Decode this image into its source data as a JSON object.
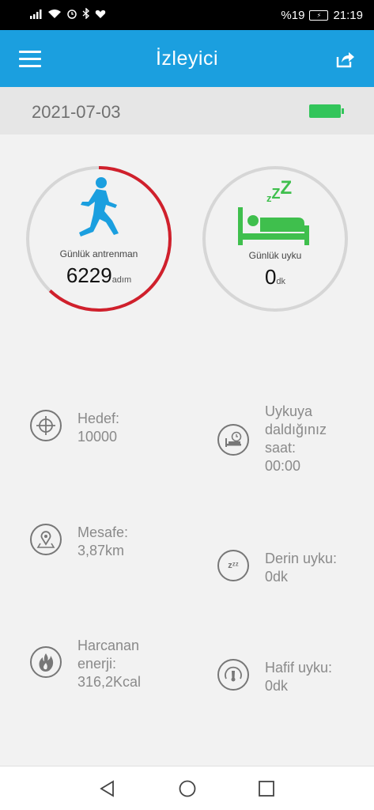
{
  "status": {
    "battery_pct": "%19",
    "time": "21:19",
    "icons": [
      "signal-icon",
      "wifi-icon",
      "alarm-icon",
      "bluetooth-icon",
      "heart-icon",
      "battery-charging-icon"
    ]
  },
  "app": {
    "title": "İzleyici"
  },
  "date": "2021-07-03",
  "exercise": {
    "label": "Günlük antrenman",
    "value": "6229",
    "unit": "adım",
    "progress": 0.62,
    "color": "#d0202c"
  },
  "sleep": {
    "label": "Günlük uyku",
    "value": "0",
    "unit": "dk",
    "progress": 0,
    "color": "#3fbf4d",
    "zzz": "zZZ"
  },
  "stats_left": [
    {
      "label": "Hedef:",
      "value": "10000",
      "icon": "target-icon"
    },
    {
      "label": "Mesafe:",
      "value": "3,87km",
      "icon": "location-pin-icon"
    },
    {
      "label": "Harcanan enerji:",
      "value": "316,2Kcal",
      "icon": "flame-icon"
    }
  ],
  "stats_right": [
    {
      "label": "Uykuya daldığınız saat:",
      "value": "00:00",
      "icon": "bed-clock-icon"
    },
    {
      "label": "Derin uyku:",
      "value": "0dk",
      "icon": "zzz-icon"
    },
    {
      "label": "Hafif uyku:",
      "value": "0dk",
      "icon": "gauge-icon"
    }
  ],
  "colors": {
    "accent": "#1b9fdf",
    "battery": "#32c55a"
  }
}
